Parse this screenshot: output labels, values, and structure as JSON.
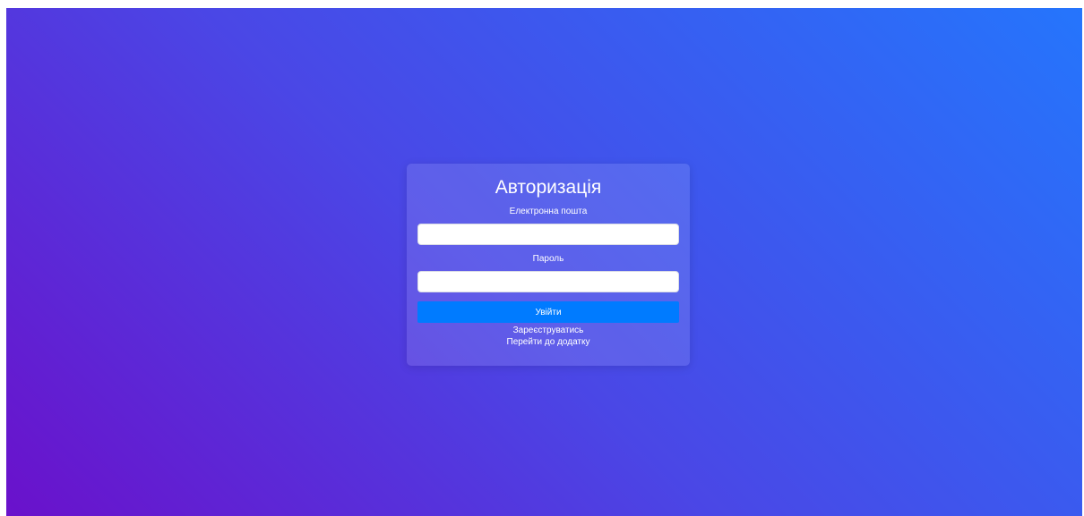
{
  "login": {
    "title": "Авторизація",
    "email_label": "Електронна пошта",
    "email_value": "",
    "password_label": "Пароль",
    "password_value": "",
    "submit_label": "Увійти",
    "register_link": "Зареєструватись",
    "app_link": "Перейти до додатку"
  },
  "colors": {
    "gradient_start": "#6a11cb",
    "gradient_end": "#2575fc",
    "button": "#007bff",
    "text": "#ffffff"
  }
}
